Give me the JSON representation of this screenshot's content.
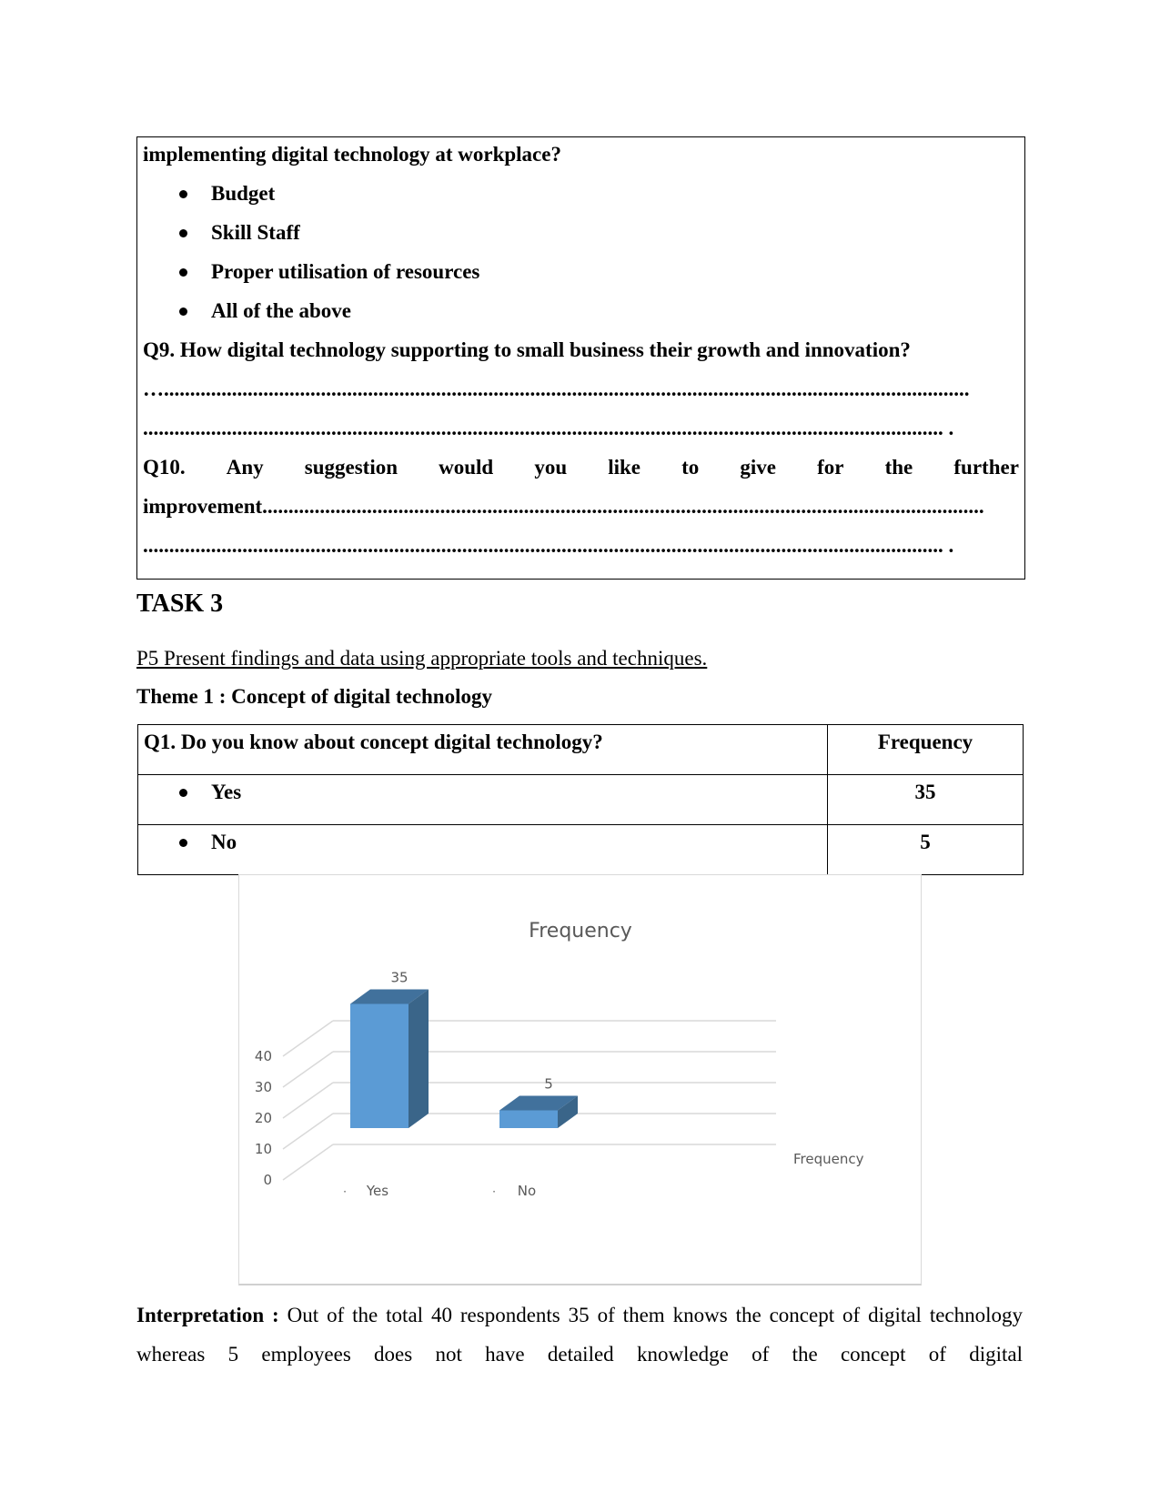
{
  "survey_box": {
    "q8_continuation": "implementing digital technology at workplace?",
    "q8_options": [
      "Budget",
      "Skill Staff",
      "Proper utilisation of resources",
      "All of the above"
    ],
    "q9": "Q9. How digital technology supporting to small business their growth and innovation?",
    "q9_answer_line1": "…..........................................................................................................................................................",
    "q9_answer_line2": "......................................................................................................................................................... .",
    "q10_words": [
      "Q10.",
      "Any",
      "suggestion",
      "would",
      "you",
      "like",
      "to",
      "give",
      "for",
      "the",
      "further"
    ],
    "q10_line2": "improvement..........................................................................................................................................",
    "q10_answer_line": "......................................................................................................................................................... ."
  },
  "task": {
    "title": "TASK 3",
    "p5_link": "P5 Present findings and data using appropriate tools and techniques.",
    "theme_title": "Theme 1 : Concept of digital technology"
  },
  "table": {
    "question": "Q1. Do you know about concept digital technology?",
    "freq_header": "Frequency",
    "rows": [
      {
        "label": "Yes",
        "value": "35"
      },
      {
        "label": "No",
        "value": "5"
      }
    ]
  },
  "chart_data": {
    "type": "bar",
    "style": "3d-column",
    "title": "Frequency",
    "categories": [
      "Yes",
      "No"
    ],
    "series": [
      {
        "name": "Frequency",
        "values": [
          35,
          5
        ],
        "color": "#5b9bd5"
      }
    ],
    "data_labels": [
      "35",
      "5"
    ],
    "y_ticks": [
      "0",
      "10",
      "20",
      "30",
      "40"
    ],
    "ylim": [
      0,
      40
    ],
    "xlabel": "",
    "ylabel": "",
    "grid": true,
    "legend": {
      "position": "right",
      "entries": [
        "Frequency"
      ]
    }
  },
  "interpretation": {
    "label": "Interpretation :",
    "text": "Out of the total 40 respondents 35 of them knows the concept of digital technology whereas 5 employees does not have detailed knowledge of the concept of digital"
  },
  "colors": {
    "bar_front": "#5b9bd5",
    "bar_top": "#41719c",
    "bar_side": "#3a6589",
    "grid": "#d9d9d9",
    "axis_text": "#595959"
  }
}
